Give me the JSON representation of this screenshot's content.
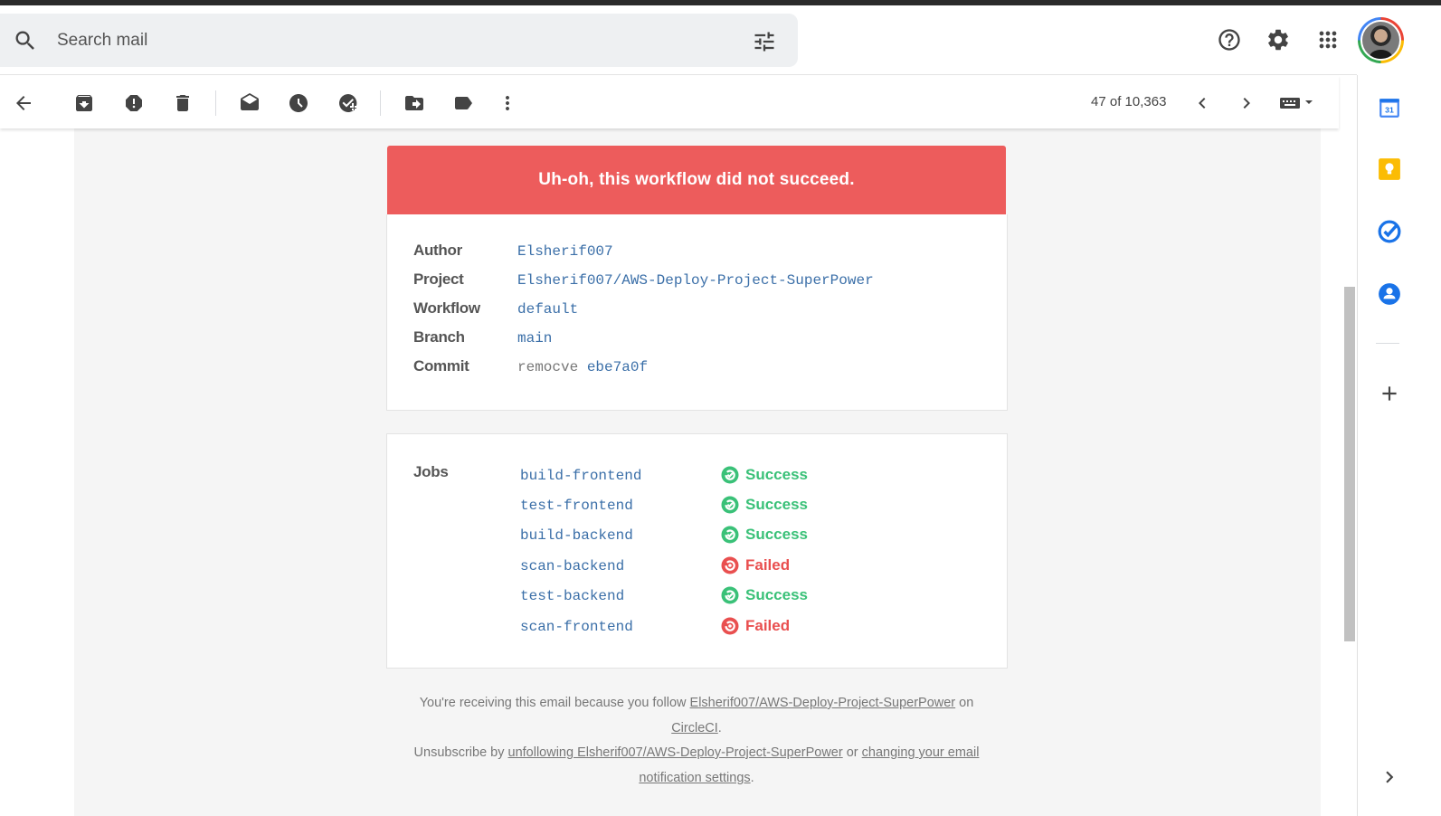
{
  "search": {
    "placeholder": "Search mail"
  },
  "toolbar": {
    "count": "47 of 10,363"
  },
  "email": {
    "banner": "Uh-oh, this workflow did not succeed.",
    "details": [
      {
        "label": "Author",
        "value": "Elsherif007"
      },
      {
        "label": "Project",
        "value": "Elsherif007/AWS-Deploy-Project-SuperPower"
      },
      {
        "label": "Workflow",
        "value": "default"
      },
      {
        "label": "Branch",
        "value": "main"
      },
      {
        "label": "Commit",
        "message": "remocve",
        "sha": "ebe7a0f"
      }
    ],
    "jobs_label": "Jobs",
    "jobs": [
      {
        "name": "build-frontend",
        "status": "Success"
      },
      {
        "name": "test-frontend",
        "status": "Success"
      },
      {
        "name": "build-backend",
        "status": "Success"
      },
      {
        "name": "scan-backend",
        "status": "Failed"
      },
      {
        "name": "test-backend",
        "status": "Success"
      },
      {
        "name": "scan-frontend",
        "status": "Failed"
      }
    ],
    "footer": {
      "line1_prefix": "You're receiving this email because you follow ",
      "line1_link": "Elsherif007/AWS-Deploy-Project-SuperPower",
      "line1_mid": " on ",
      "line1_link2": "CircleCI",
      "line1_suffix": ".",
      "line2_prefix": "Unsubscribe by ",
      "line2_link": "unfollowing Elsherif007/AWS-Deploy-Project-SuperPower",
      "line2_mid": " or ",
      "line2_link2": "changing your email notification settings",
      "line2_suffix": "."
    }
  },
  "colors": {
    "banner": "#ed5c5c",
    "success": "#3ac178",
    "failed": "#e94f4f",
    "link": "#3b6fa8"
  },
  "icons": {
    "top": [
      "help-icon",
      "settings-icon",
      "apps-icon"
    ],
    "toolbar": [
      "back-arrow-icon",
      "archive-icon",
      "report-spam-icon",
      "delete-icon",
      "mark-unread-icon",
      "snooze-icon",
      "add-to-tasks-icon",
      "move-to-icon",
      "label-icon",
      "more-icon",
      "newer-icon",
      "older-icon",
      "input-tools-icon"
    ],
    "rail": [
      "calendar-icon",
      "keep-icon",
      "tasks-icon",
      "contacts-icon",
      "add-icon",
      "expand-icon"
    ]
  }
}
